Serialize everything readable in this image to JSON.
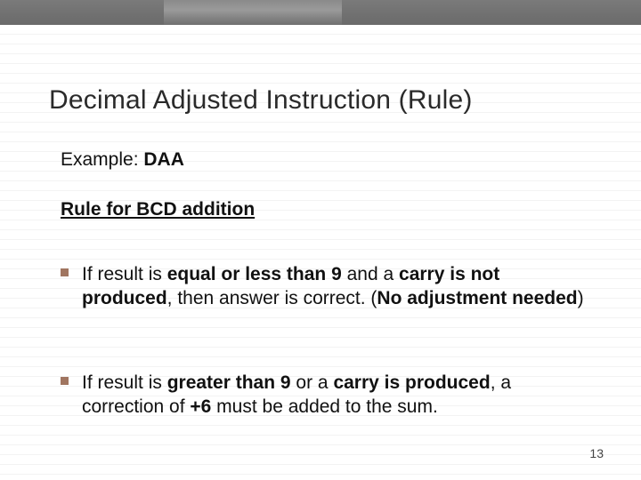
{
  "title": "Decimal Adjusted Instruction (Rule)",
  "example": {
    "label": "Example: ",
    "instruction": "DAA"
  },
  "rule_heading": "Rule for BCD addition",
  "bullets": [
    {
      "pre1": "If result is ",
      "b1": "equal or less than 9",
      "mid1": " and a ",
      "b2": "carry is not produced",
      "mid2": ", then answer  is correct. (",
      "b3": "No adjustment needed",
      "post1": ")"
    },
    {
      "pre1": "If result is ",
      "b1": "greater than 9",
      "mid1": " or a ",
      "b2": "carry is produced",
      "mid2": ", a correction of ",
      "b3": "+6 ",
      "post1": "must be added to the sum."
    }
  ],
  "page_number": "13"
}
